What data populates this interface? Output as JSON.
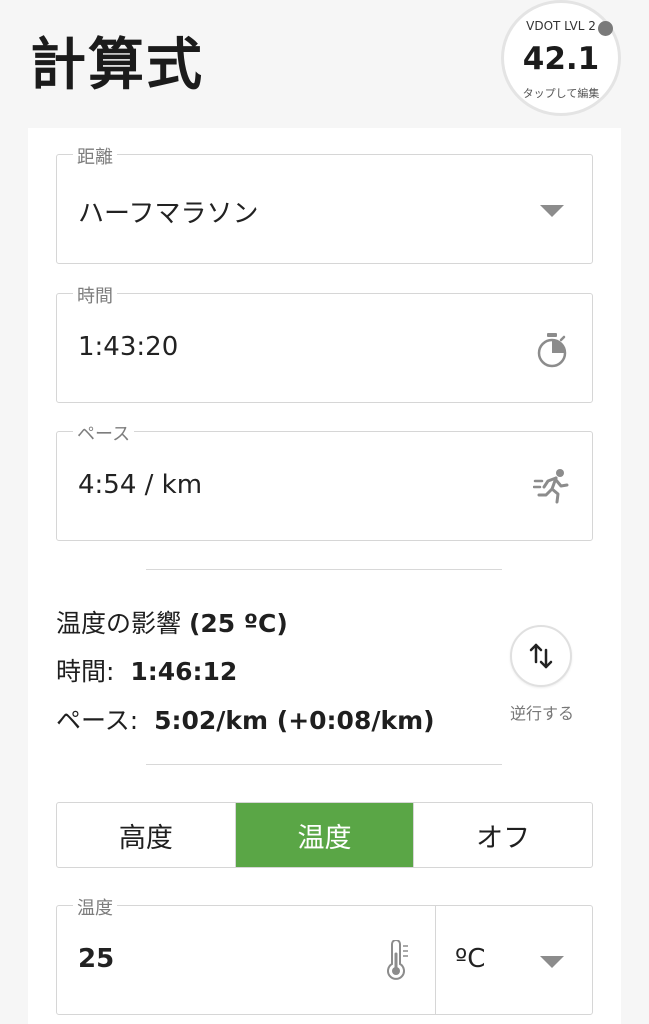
{
  "header": {
    "title": "計算式"
  },
  "vdot": {
    "label": "VDOT LVL 2",
    "value": "42.1",
    "hint": "タップして編集"
  },
  "distance": {
    "label": "距離",
    "value": "ハーフマラソン"
  },
  "time": {
    "label": "時間",
    "value": "1:43:20"
  },
  "pace": {
    "label": "ペース",
    "value": "4:54 / km"
  },
  "effect": {
    "heading_prefix": "温度の影響 ",
    "heading_value": "(25 ºC)",
    "time_label": "時間:",
    "time_value": "1:46:12",
    "pace_label": "ペース:",
    "pace_value": "5:02/km (+0:08/km)",
    "reverse_label": "逆行する"
  },
  "segments": [
    {
      "label": "高度",
      "active": false
    },
    {
      "label": "温度",
      "active": true
    },
    {
      "label": "オフ",
      "active": false
    }
  ],
  "temperature": {
    "label": "温度",
    "value": "25",
    "unit": "ºC"
  },
  "colors": {
    "accent": "#5aa646",
    "border": "#d6d6d6",
    "label": "#7d7d7d"
  }
}
